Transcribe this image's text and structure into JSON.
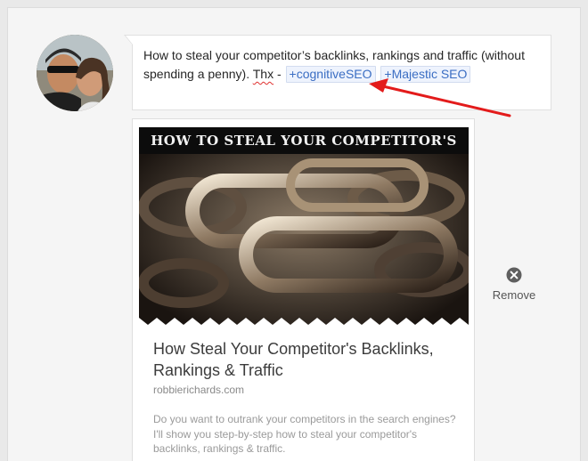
{
  "post": {
    "text_line1": "How to steal your competitor’s backlinks, rankings and traffic (without",
    "text_line2_prefix": "spending a penny). ",
    "thx": "Thx",
    "separator": " - ",
    "mentions": [
      "+cognitiveSEO",
      "+Majestic SEO"
    ]
  },
  "link_card": {
    "image_banner": "HOW TO STEAL YOUR COMPETITOR'S",
    "title": "How Steal Your Competitor's Backlinks, Rankings & Traffic",
    "domain": "robbierichards.com",
    "description": "Do you want to outrank your competitors in the search engines? I'll show you step-by-step how to steal your competitor's backlinks, rankings & traffic."
  },
  "actions": {
    "remove_label": "Remove"
  },
  "colors": {
    "mention_text": "#3b6ec3",
    "arrow": "#e31b1b"
  },
  "icons": {
    "remove": "close-circle-icon"
  }
}
